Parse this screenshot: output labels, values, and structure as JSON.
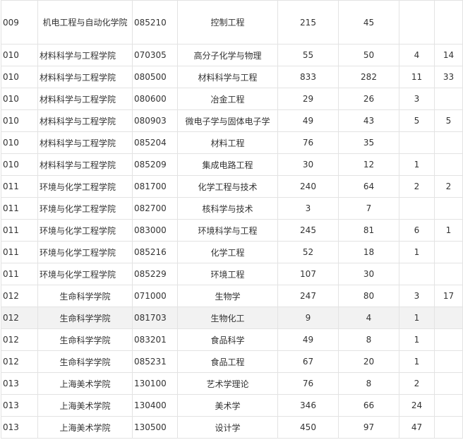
{
  "rows": [
    {
      "code": "009",
      "school": "机电工程与自动化学院",
      "major_code": "085210",
      "major": "控制工程",
      "n1": "215",
      "n2": "45",
      "n3": "",
      "n4": ""
    },
    {
      "code": "010",
      "school": "材料科学与工程学院",
      "major_code": "070305",
      "major": "高分子化学与物理",
      "n1": "55",
      "n2": "50",
      "n3": "4",
      "n4": "14"
    },
    {
      "code": "010",
      "school": "材料科学与工程学院",
      "major_code": "080500",
      "major": "材料科学与工程",
      "n1": "833",
      "n2": "282",
      "n3": "11",
      "n4": "33"
    },
    {
      "code": "010",
      "school": "材料科学与工程学院",
      "major_code": "080600",
      "major": "冶金工程",
      "n1": "29",
      "n2": "26",
      "n3": "3",
      "n4": ""
    },
    {
      "code": "010",
      "school": "材料科学与工程学院",
      "major_code": "080903",
      "major": "微电子学与固体电子学",
      "n1": "49",
      "n2": "43",
      "n3": "5",
      "n4": "5"
    },
    {
      "code": "010",
      "school": "材料科学与工程学院",
      "major_code": "085204",
      "major": "材料工程",
      "n1": "76",
      "n2": "35",
      "n3": "",
      "n4": ""
    },
    {
      "code": "010",
      "school": "材料科学与工程学院",
      "major_code": "085209",
      "major": "集成电路工程",
      "n1": "30",
      "n2": "12",
      "n3": "1",
      "n4": ""
    },
    {
      "code": "011",
      "school": "环境与化学工程学院",
      "major_code": "081700",
      "major": "化学工程与技术",
      "n1": "240",
      "n2": "64",
      "n3": "2",
      "n4": "2"
    },
    {
      "code": "011",
      "school": "环境与化学工程学院",
      "major_code": "082700",
      "major": "核科学与技术",
      "n1": "3",
      "n2": "7",
      "n3": "",
      "n4": ""
    },
    {
      "code": "011",
      "school": "环境与化学工程学院",
      "major_code": "083000",
      "major": "环境科学与工程",
      "n1": "245",
      "n2": "81",
      "n3": "6",
      "n4": "1"
    },
    {
      "code": "011",
      "school": "环境与化学工程学院",
      "major_code": "085216",
      "major": "化学工程",
      "n1": "52",
      "n2": "18",
      "n3": "1",
      "n4": ""
    },
    {
      "code": "011",
      "school": "环境与化学工程学院",
      "major_code": "085229",
      "major": "环境工程",
      "n1": "107",
      "n2": "30",
      "n3": "",
      "n4": ""
    },
    {
      "code": "012",
      "school": "生命科学学院",
      "major_code": "071000",
      "major": "生物学",
      "n1": "247",
      "n2": "80",
      "n3": "3",
      "n4": "17"
    },
    {
      "code": "012",
      "school": "生命科学学院",
      "major_code": "081703",
      "major": "生物化工",
      "n1": "9",
      "n2": "4",
      "n3": "1",
      "n4": ""
    },
    {
      "code": "012",
      "school": "生命科学学院",
      "major_code": "083201",
      "major": "食品科学",
      "n1": "49",
      "n2": "8",
      "n3": "1",
      "n4": ""
    },
    {
      "code": "012",
      "school": "生命科学学院",
      "major_code": "085231",
      "major": "食品工程",
      "n1": "67",
      "n2": "20",
      "n3": "1",
      "n4": ""
    },
    {
      "code": "013",
      "school": "上海美术学院",
      "major_code": "130100",
      "major": "艺术学理论",
      "n1": "76",
      "n2": "8",
      "n3": "2",
      "n4": ""
    },
    {
      "code": "013",
      "school": "上海美术学院",
      "major_code": "130400",
      "major": "美术学",
      "n1": "346",
      "n2": "66",
      "n3": "24",
      "n4": ""
    },
    {
      "code": "013",
      "school": "上海美术学院",
      "major_code": "130500",
      "major": "设计学",
      "n1": "450",
      "n2": "97",
      "n3": "47",
      "n4": ""
    }
  ]
}
